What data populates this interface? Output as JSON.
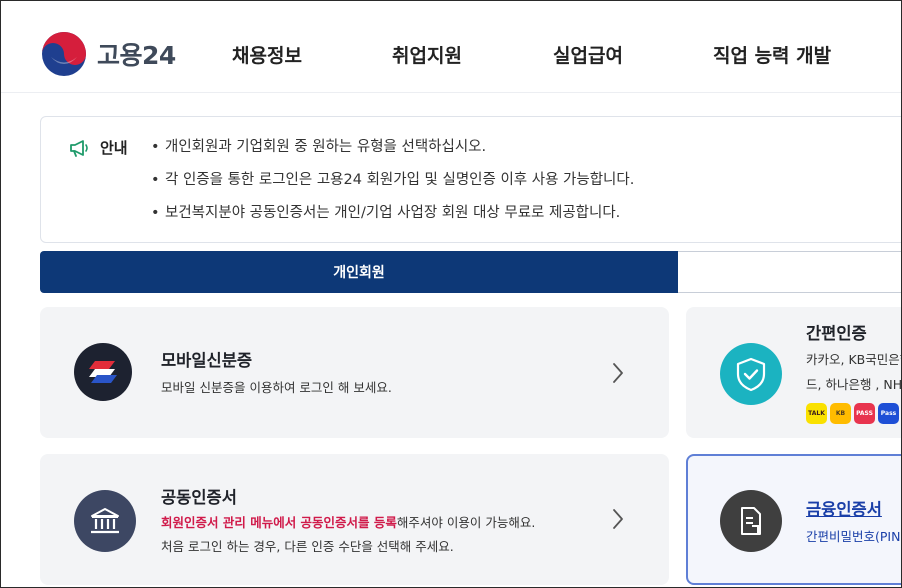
{
  "header": {
    "logo_text": "고용24",
    "nav": [
      "채용정보",
      "취업지원",
      "실업급여",
      "직업 능력 개발"
    ]
  },
  "notice": {
    "label": "안내",
    "lines": [
      "개인회원과 기업회원 중 원하는 유형을 선택하십시오.",
      "각 인증을 통한 로그인은 고용24 회원가입 및 실명인증 이후 사용 가능합니다.",
      "보건복지분야 공동인증서는 개인/기업 사업장 회원 대상 무료로 제공합니다."
    ]
  },
  "tabs": {
    "personal": "개인회원",
    "corporate": ""
  },
  "cards": {
    "mobile_id": {
      "title": "모바일신분증",
      "desc": "모바일 신분증을 이용하여 로그인 해 보세요."
    },
    "simple_auth": {
      "title": "간편인증",
      "desc1": "카카오, KB국민은행",
      "desc2": "드, 하나은행 , NH,",
      "badges": [
        "TALK",
        "KB",
        "PASS",
        "Pass"
      ]
    },
    "joint_cert": {
      "title": "공동인증서",
      "desc_em": "회원인증서 관리 메뉴에서 공동인증서를 등록",
      "desc_rest": "해주셔야 이용이 가능해요.",
      "desc2": "처음 로그인 하는 경우, 다른 인증 수단을 선택해 주세요."
    },
    "finance_cert": {
      "title": "금융인증서",
      "desc": "간편비밀번호(PIN"
    }
  },
  "colors": {
    "primary": "#0d3877",
    "card_bg": "#f3f4f6",
    "emphasis": "#d01a4a",
    "link": "#1a3fa8",
    "teal": "#1bb3c1"
  }
}
